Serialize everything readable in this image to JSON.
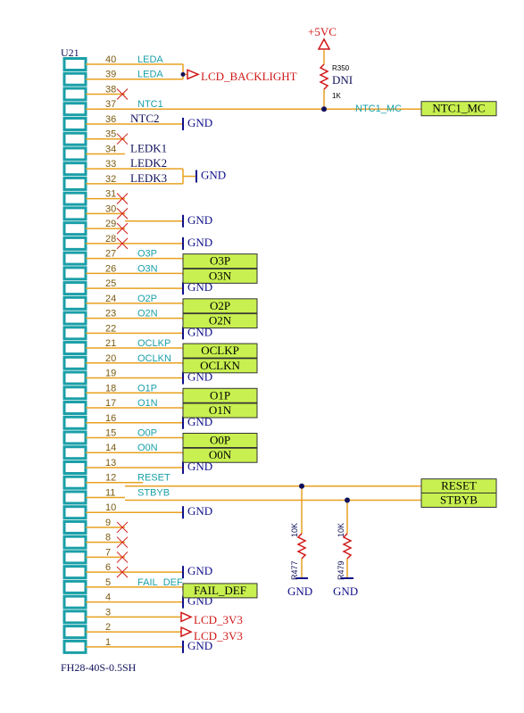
{
  "component": {
    "ref": "U21",
    "part": "FH28-40S-0.5SH"
  },
  "pins": [
    {
      "n": "40",
      "name": "LEDA"
    },
    {
      "n": "39",
      "name": "LEDA"
    },
    {
      "n": "38",
      "name": ""
    },
    {
      "n": "37",
      "name": "NTC1"
    },
    {
      "n": "36",
      "name": "NTC2"
    },
    {
      "n": "35",
      "name": ""
    },
    {
      "n": "34",
      "name": "LEDK1"
    },
    {
      "n": "33",
      "name": "LEDK2"
    },
    {
      "n": "32",
      "name": "LEDK3"
    },
    {
      "n": "31",
      "name": ""
    },
    {
      "n": "30",
      "name": ""
    },
    {
      "n": "29",
      "name": ""
    },
    {
      "n": "28",
      "name": ""
    },
    {
      "n": "27",
      "name": "O3P"
    },
    {
      "n": "26",
      "name": "O3N"
    },
    {
      "n": "25",
      "name": ""
    },
    {
      "n": "24",
      "name": "O2P"
    },
    {
      "n": "23",
      "name": "O2N"
    },
    {
      "n": "22",
      "name": ""
    },
    {
      "n": "21",
      "name": "OCLKP"
    },
    {
      "n": "20",
      "name": "OCLKN"
    },
    {
      "n": "19",
      "name": ""
    },
    {
      "n": "18",
      "name": "O1P"
    },
    {
      "n": "17",
      "name": "O1N"
    },
    {
      "n": "16",
      "name": ""
    },
    {
      "n": "15",
      "name": "O0P"
    },
    {
      "n": "14",
      "name": "O0N"
    },
    {
      "n": "13",
      "name": ""
    },
    {
      "n": "12",
      "name": "RESET"
    },
    {
      "n": "11",
      "name": "STBYB"
    },
    {
      "n": "10",
      "name": ""
    },
    {
      "n": "9",
      "name": ""
    },
    {
      "n": "8",
      "name": ""
    },
    {
      "n": "7",
      "name": ""
    },
    {
      "n": "6",
      "name": ""
    },
    {
      "n": "5",
      "name": "FAIL_DEF"
    },
    {
      "n": "4",
      "name": ""
    },
    {
      "n": "3",
      "name": ""
    },
    {
      "n": "2",
      "name": ""
    },
    {
      "n": "1",
      "name": ""
    }
  ],
  "gnd_label": "GND",
  "lcd_backlight": "LCD_BACKLIGHT",
  "lcd_3v3": "LCD_3V3",
  "ports": {
    "o3p": "O3P",
    "o3n": "O3N",
    "o2p": "O2P",
    "o2n": "O2N",
    "oclkp": "OCLKP",
    "oclkn": "OCLKN",
    "o1p": "O1P",
    "o1n": "O1N",
    "o0p": "O0P",
    "o0n": "O0N",
    "ntc1_mc": "NTC1_MC",
    "reset": "RESET",
    "stbyb": "STBYB",
    "fail_def": "FAIL_DEF"
  },
  "net_ntc1_mc": "NTC1_MC",
  "r350": {
    "ref": "R350",
    "value": "1K",
    "note": "DNI",
    "supply": "+5VC"
  },
  "r477": {
    "ref": "R477",
    "value": "10K"
  },
  "r479": {
    "ref": "R479",
    "value": "10K"
  },
  "colors": {
    "wire": "#e8a020",
    "pin": "#1a9fa8",
    "gnd": "#10108a",
    "red": "#d01818",
    "port_fill": "#c8f050"
  }
}
